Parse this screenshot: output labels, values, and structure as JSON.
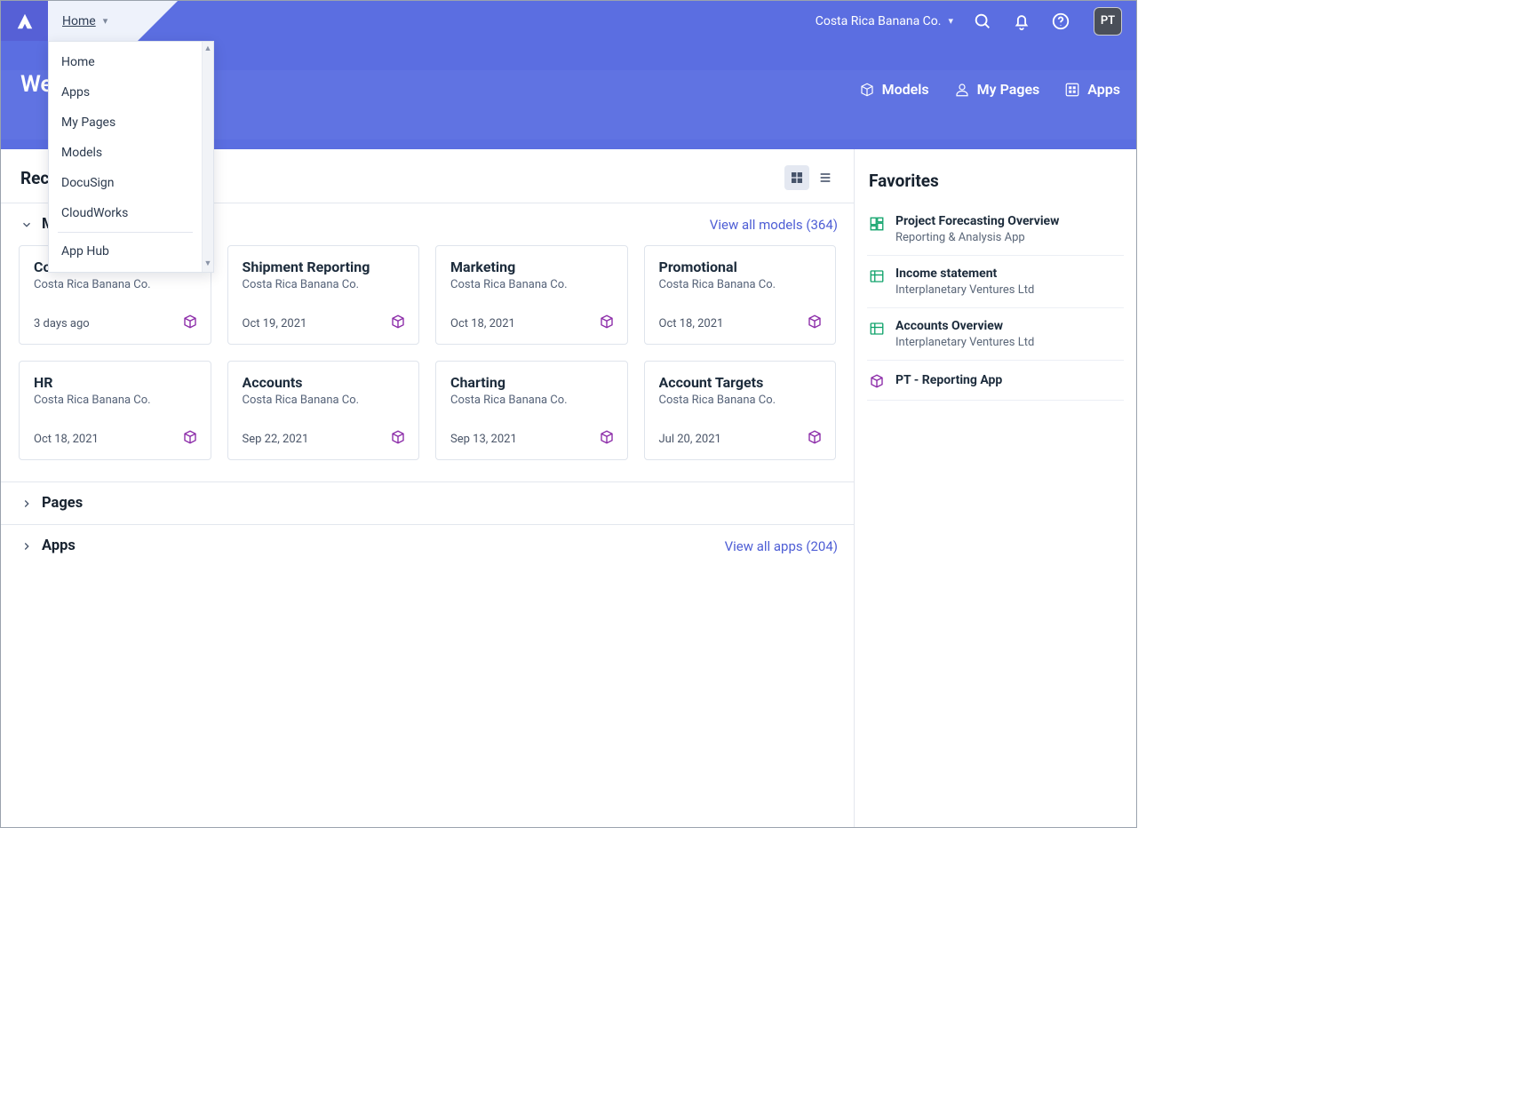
{
  "header": {
    "crumb_label": "Home",
    "workspace": "Costa Rica Banana Co.",
    "avatar_initials": "PT",
    "welcome": "Welcome"
  },
  "nav": {
    "models": "Models",
    "mypages": "My Pages",
    "apps": "Apps"
  },
  "dropdown": {
    "items": [
      "Home",
      "Apps",
      "My Pages",
      "Models",
      "DocuSign",
      "CloudWorks"
    ],
    "items_after_sep": [
      "App Hub"
    ]
  },
  "recent": {
    "heading": "Recently used",
    "view_toggle": {
      "grid_active": true
    }
  },
  "models_section": {
    "heading": "Models",
    "viewall": "View all models (364)",
    "cards": [
      {
        "title": "Costa Rica Banana",
        "subtitle": "Costa Rica Banana Co.",
        "date": "3 days ago",
        "favorite": true
      },
      {
        "title": "Shipment Reporting",
        "subtitle": "Costa Rica Banana Co.",
        "date": "Oct 19, 2021",
        "favorite": false
      },
      {
        "title": "Marketing",
        "subtitle": "Costa Rica Banana Co.",
        "date": "Oct 18, 2021",
        "favorite": false
      },
      {
        "title": "Promotional",
        "subtitle": "Costa Rica Banana Co.",
        "date": "Oct 18, 2021",
        "favorite": false
      },
      {
        "title": "HR",
        "subtitle": "Costa Rica Banana Co.",
        "date": "Oct 18, 2021",
        "favorite": false
      },
      {
        "title": "Accounts",
        "subtitle": "Costa Rica Banana Co.",
        "date": "Sep 22, 2021",
        "favorite": false
      },
      {
        "title": "Charting",
        "subtitle": "Costa Rica Banana Co.",
        "date": "Sep 13, 2021",
        "favorite": false
      },
      {
        "title": "Account Targets",
        "subtitle": "Costa Rica Banana Co.",
        "date": "Jul 20, 2021",
        "favorite": false
      }
    ]
  },
  "pages_section": {
    "heading": "Pages"
  },
  "apps_section": {
    "heading": "Apps",
    "viewall": "View all apps (204)"
  },
  "favorites": {
    "heading": "Favorites",
    "items": [
      {
        "title": "Project Forecasting Overview",
        "subtitle": "Reporting & Analysis App",
        "icon": "dashboard",
        "color": "#11a36c"
      },
      {
        "title": "Income statement",
        "subtitle": "Interplanetary Ventures Ltd",
        "icon": "table",
        "color": "#11a36c"
      },
      {
        "title": "Accounts Overview",
        "subtitle": "Interplanetary Ventures Ltd",
        "icon": "table",
        "color": "#11a36c"
      },
      {
        "title": "PT - Reporting App",
        "subtitle": "",
        "icon": "model",
        "color": "#8b2aa8"
      }
    ]
  },
  "icons": {
    "search": "search-icon",
    "bell": "bell-icon",
    "help": "help-icon"
  }
}
